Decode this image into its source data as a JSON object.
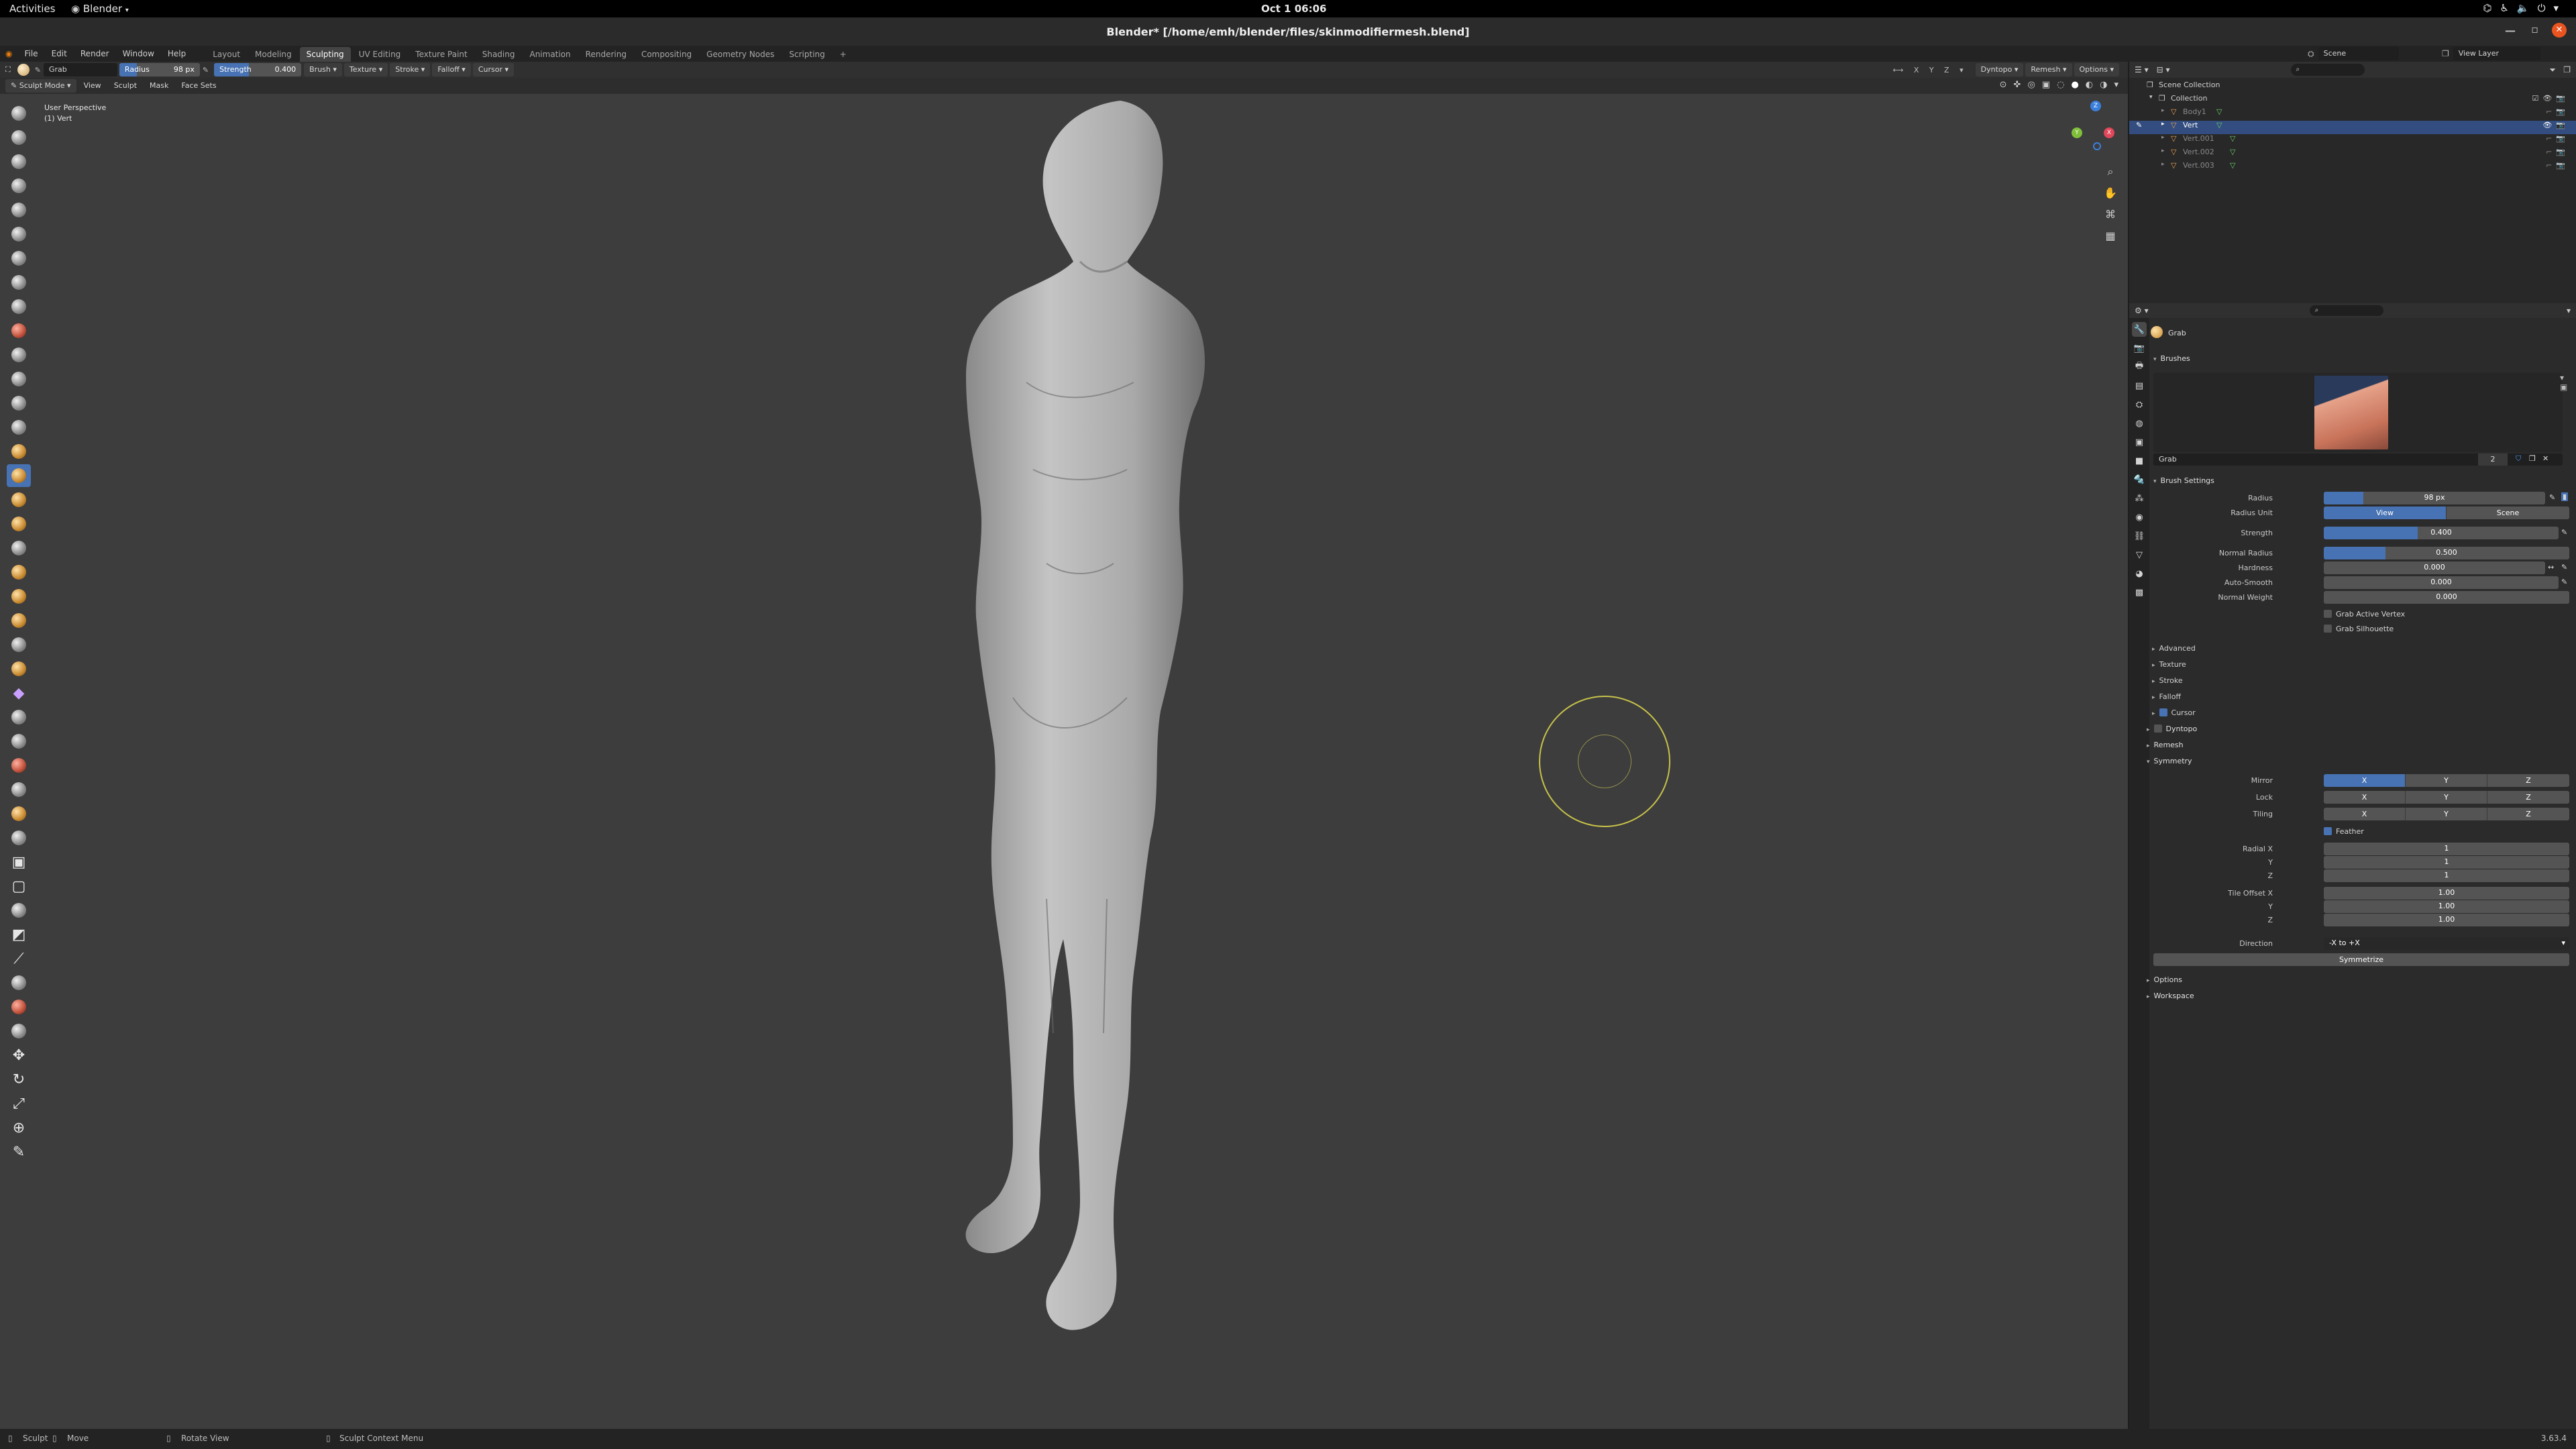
{
  "gnome": {
    "activities": "Activities",
    "app": "Blender",
    "clock": "Oct 1  06:06"
  },
  "window": {
    "title": "Blender* [/home/emh/blender/files/skinmodifiermesh.blend]"
  },
  "topbar": {
    "menus": [
      "File",
      "Edit",
      "Render",
      "Window",
      "Help"
    ],
    "workspaces": [
      "Layout",
      "Modeling",
      "Sculpting",
      "UV Editing",
      "Texture Paint",
      "Shading",
      "Animation",
      "Rendering",
      "Compositing",
      "Geometry Nodes",
      "Scripting"
    ],
    "active_workspace": 2,
    "add": "+",
    "scene": "Scene",
    "view_layer": "View Layer"
  },
  "toolhdr": {
    "brush_name": "Grab",
    "radius_label": "Radius",
    "radius_value": "98 px",
    "strength_label": "Strength",
    "strength_value": "0.400",
    "menus": [
      "Brush",
      "Texture",
      "Stroke",
      "Falloff",
      "Cursor"
    ],
    "right": [
      "Dyntopo",
      "Remesh",
      "Options"
    ]
  },
  "vphdr": {
    "mode": "Sculpt Mode",
    "menus": [
      "View",
      "Sculpt",
      "Mask",
      "Face Sets"
    ]
  },
  "viewport": {
    "perspective": "User Perspective",
    "object": "(1) Vert",
    "gizmo": {
      "x": "X",
      "y": "Y",
      "z": "Z"
    }
  },
  "outliner": {
    "root": "Scene Collection",
    "collection": "Collection",
    "items": [
      "Body1",
      "Vert",
      "Vert.001",
      "Vert.002",
      "Vert.003"
    ]
  },
  "props": {
    "tool_name": "Grab",
    "brushes_header": "Brushes",
    "brush_field": "Grab",
    "brush_users": "2",
    "brush_settings": "Brush Settings",
    "radius_label": "Radius",
    "radius_value": "98 px",
    "radius_fraction": 0.18,
    "radius_unit_label": "Radius Unit",
    "radius_unit_view": "View",
    "radius_unit_scene": "Scene",
    "strength_label": "Strength",
    "strength_value": "0.400",
    "strength_fraction": 0.4,
    "normal_radius_label": "Normal Radius",
    "normal_radius_value": "0.500",
    "normal_radius_fraction": 0.25,
    "hardness_label": "Hardness",
    "hardness_value": "0.000",
    "autosmooth_label": "Auto-Smooth",
    "autosmooth_value": "0.000",
    "normal_weight_label": "Normal Weight",
    "normal_weight_value": "0.000",
    "grab_active_vertex": "Grab Active Vertex",
    "grab_silhouette": "Grab Silhouette",
    "subpanels": [
      "Advanced",
      "Texture",
      "Stroke",
      "Falloff"
    ],
    "cursor": "Cursor",
    "dyntopo": "Dyntopo",
    "remesh": "Remesh",
    "symmetry": "Symmetry",
    "mirror_label": "Mirror",
    "lock_label": "Lock",
    "tiling_label": "Tiling",
    "axes": [
      "X",
      "Y",
      "Z"
    ],
    "feather": "Feather",
    "radial_x_label": "Radial X",
    "radial_y_label": "Y",
    "radial_z_label": "Z",
    "radial_x": "1",
    "radial_y": "1",
    "radial_z": "1",
    "tile_x_label": "Tile Offset X",
    "tile_y_label": "Y",
    "tile_z_label": "Z",
    "tile_x": "1.00",
    "tile_y": "1.00",
    "tile_z": "1.00",
    "direction_label": "Direction",
    "direction_value": "-X to +X",
    "symmetrize": "Symmetrize",
    "options": "Options",
    "workspace": "Workspace"
  },
  "status": {
    "sculpt": "Sculpt",
    "move": "Move",
    "rotate": "Rotate View",
    "context": "Sculpt Context Menu",
    "version": "3.63.4"
  }
}
